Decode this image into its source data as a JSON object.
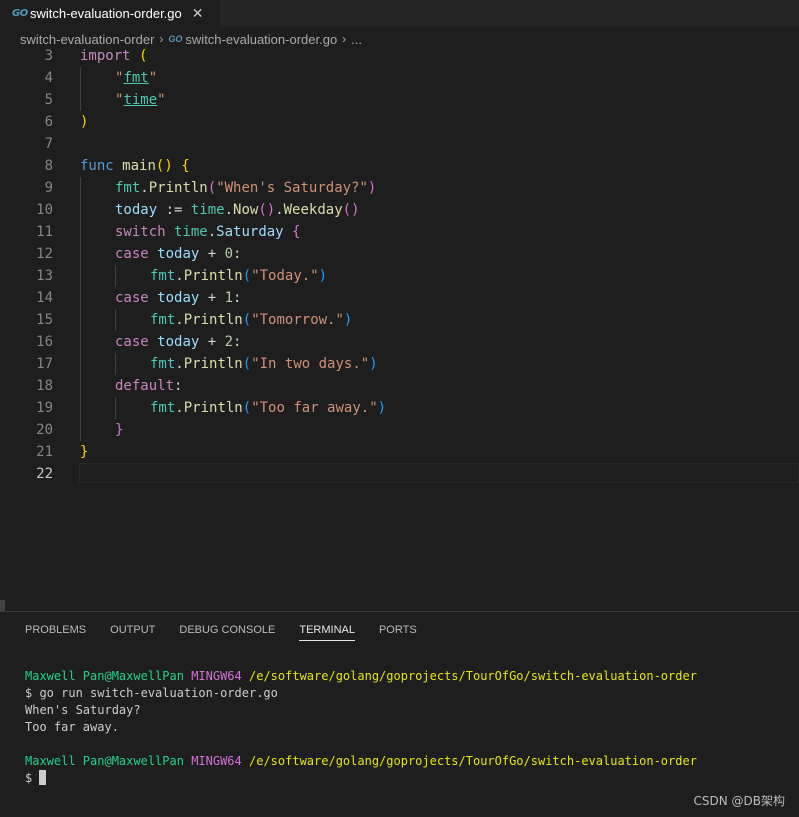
{
  "tab": {
    "icon": "go-file-icon",
    "icon_text": "GO",
    "label": "switch-evaluation-order.go",
    "close": "✕"
  },
  "breadcrumb": {
    "folder": "switch-evaluation-order",
    "file": "switch-evaluation-order.go",
    "more": "..."
  },
  "editor": {
    "line_numbers": [
      "3",
      "4",
      "5",
      "6",
      "7",
      "8",
      "9",
      "10",
      "11",
      "12",
      "13",
      "14",
      "15",
      "16",
      "17",
      "18",
      "19",
      "20",
      "21",
      "22"
    ],
    "active_line": "22",
    "code": {
      "l3": [
        "import",
        " ",
        "("
      ],
      "l4": [
        "\"",
        "fmt",
        "\""
      ],
      "l5": [
        "\"",
        "time",
        "\""
      ],
      "l6": [
        ")"
      ],
      "l8": [
        "func",
        " ",
        "main",
        "(",
        ")",
        " ",
        "{"
      ],
      "l9": [
        "fmt",
        ".",
        "Println",
        "(",
        "\"When's Saturday?\"",
        ")"
      ],
      "l10": [
        "today",
        " := ",
        "time",
        ".",
        "Now",
        "()",
        ".",
        "Weekday",
        "()"
      ],
      "l11": [
        "switch",
        " ",
        "time",
        ".",
        "Saturday",
        " ",
        "{"
      ],
      "l12": [
        "case",
        " ",
        "today",
        " + ",
        "0",
        ":"
      ],
      "l13": [
        "fmt",
        ".",
        "Println",
        "(",
        "\"Today.\"",
        ")"
      ],
      "l14": [
        "case",
        " ",
        "today",
        " + ",
        "1",
        ":"
      ],
      "l15": [
        "fmt",
        ".",
        "Println",
        "(",
        "\"Tomorrow.\"",
        ")"
      ],
      "l16": [
        "case",
        " ",
        "today",
        " + ",
        "2",
        ":"
      ],
      "l17": [
        "fmt",
        ".",
        "Println",
        "(",
        "\"In two days.\"",
        ")"
      ],
      "l18": [
        "default",
        ":"
      ],
      "l19": [
        "fmt",
        ".",
        "Println",
        "(",
        "\"Too far away.\"",
        ")"
      ],
      "l20": [
        "}"
      ],
      "l21": [
        "}"
      ]
    }
  },
  "panel": {
    "tabs": [
      "PROBLEMS",
      "OUTPUT",
      "DEBUG CONSOLE",
      "TERMINAL",
      "PORTS"
    ],
    "active_tab": "TERMINAL",
    "terminal": {
      "prompt_user": "Maxwell Pan@MaxwellPan",
      "prompt_env": "MINGW64",
      "prompt_path": "/e/software/golang/goprojects/TourOfGo/switch-evaluation-order",
      "command": "$ go run switch-evaluation-order.go",
      "output1": "When's Saturday?",
      "output2": "Too far away.",
      "prompt_symbol": "$ "
    }
  },
  "watermark": "CSDN @DB架构",
  "colors": {
    "keyword": "#c586c0",
    "keyword_blue": "#569cd6",
    "function": "#dcdcaa",
    "variable": "#9cdcfe",
    "package": "#4ec9b0",
    "string": "#ce9178",
    "number": "#b5cea8",
    "bracket_gold": "#ffd700",
    "bracket_purple": "#da70d6",
    "bracket_blue": "#179fff",
    "term_green": "#23d18b",
    "term_magenta": "#d670d6",
    "term_yellow": "#e5e510"
  }
}
